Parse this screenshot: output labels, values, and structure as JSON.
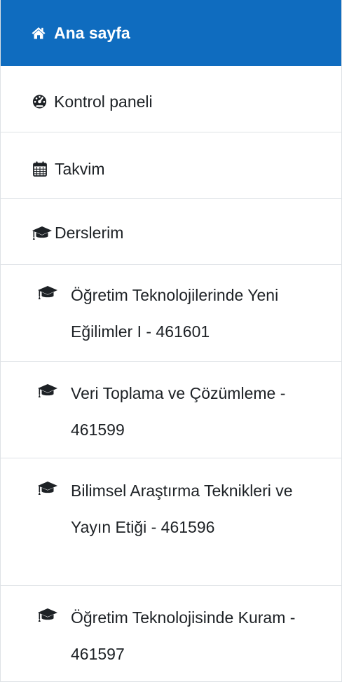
{
  "nav": {
    "home": {
      "label": "Ana sayfa",
      "icon": "home-icon",
      "active": true
    },
    "dashboard": {
      "label": "Kontrol paneli",
      "icon": "dashboard-icon"
    },
    "calendar": {
      "label": "Takvim",
      "icon": "calendar-icon"
    },
    "my_courses": {
      "label": "Derslerim",
      "icon": "graduation-cap-icon"
    },
    "courses": [
      {
        "label": "Öğretim Teknolojilerinde Yeni Eğilimler I - 461601",
        "icon": "graduation-cap-icon"
      },
      {
        "label": "Veri Toplama ve Çözümleme - 461599",
        "icon": "graduation-cap-icon"
      },
      {
        "label": "Bilimsel Araştırma Teknikleri ve Yayın Etiği - 461596",
        "icon": "graduation-cap-icon"
      },
      {
        "label": "Öğretim Teknolojisinde Kuram - 461597",
        "icon": "graduation-cap-icon"
      }
    ]
  },
  "colors": {
    "active_bg": "#0f6cbf",
    "active_text": "#ffffff",
    "text": "#1d2125",
    "divider": "#dee2e6"
  }
}
